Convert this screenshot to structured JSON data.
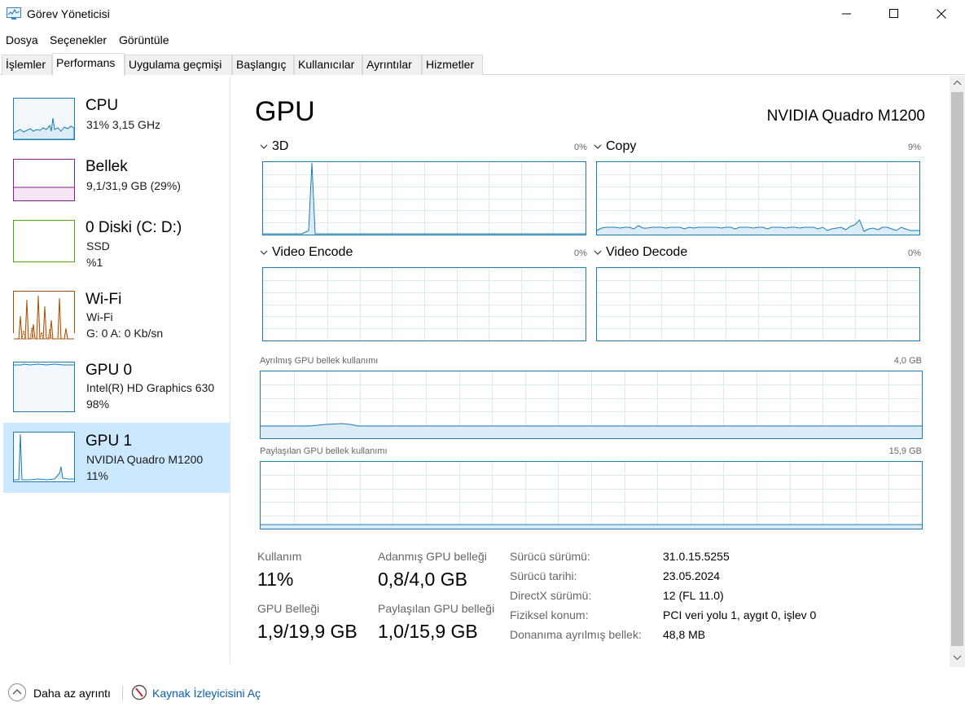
{
  "window": {
    "title": "Görev Yöneticisi"
  },
  "menu": [
    "Dosya",
    "Seçenekler",
    "Görüntüle"
  ],
  "tabs": [
    "İşlemler",
    "Performans",
    "Uygulama geçmişi",
    "Başlangıç",
    "Kullanıcılar",
    "Ayrıntılar",
    "Hizmetler"
  ],
  "active_tab": "Performans",
  "sidebar": {
    "items": [
      {
        "name": "CPU",
        "line1": "31%  3,15 GHz",
        "line2": "",
        "color": "#1b7cb5"
      },
      {
        "name": "Bellek",
        "line1": "9,1/31,9 GB (29%)",
        "line2": "",
        "color": "#8e1a8e"
      },
      {
        "name": "0 Diski (C: D:)",
        "line1": "SSD",
        "line2": "%1",
        "color": "#4da60c"
      },
      {
        "name": "Wi-Fi",
        "line1": "Wi-Fi",
        "line2": "G: 0  A: 0 Kb/sn",
        "color": "#a74f01"
      },
      {
        "name": "GPU 0",
        "line1": "Intel(R) HD Graphics 630",
        "line2": "98%",
        "color": "#1b7cb5"
      },
      {
        "name": "GPU 1",
        "line1": "NVIDIA Quadro M1200",
        "line2": "11%",
        "color": "#1b7cb5",
        "selected": true
      }
    ]
  },
  "main": {
    "title": "GPU",
    "model": "NVIDIA Quadro M1200",
    "engines": [
      {
        "label": "3D",
        "pct": "0%"
      },
      {
        "label": "Copy",
        "pct": "9%"
      },
      {
        "label": "Video Encode",
        "pct": "0%"
      },
      {
        "label": "Video Decode",
        "pct": "0%"
      }
    ],
    "dedicated_mem": {
      "label": "Ayrılmış GPU bellek kullanımı",
      "max": "4,0 GB"
    },
    "shared_mem": {
      "label": "Paylaşılan GPU bellek kullanımı",
      "max": "15,9 GB"
    },
    "stats": {
      "usage_label": "Kullanım",
      "usage_value": "11%",
      "dedicated_label": "Adanmış GPU belleği",
      "dedicated_value": "0,8/4,0 GB",
      "gpu_mem_label": "GPU Belleği",
      "gpu_mem_value": "1,9/19,9 GB",
      "shared_label": "Paylaşılan GPU belleği",
      "shared_value": "1,0/15,9 GB"
    },
    "details": [
      {
        "key": "Sürücü sürümü:",
        "value": "31.0.15.5255"
      },
      {
        "key": "Sürücü tarihi:",
        "value": "23.05.2024"
      },
      {
        "key": "DirectX sürümü:",
        "value": "12 (FL 11.0)"
      },
      {
        "key": "Fiziksel konum:",
        "value": "PCI veri yolu 1, aygıt 0, işlev 0"
      },
      {
        "key": "Donanıma ayrılmış bellek:",
        "value": "48,8 MB"
      }
    ]
  },
  "footer": {
    "less_details": "Daha az ayrıntı",
    "resource_monitor": "Kaynak İzleyicisini Aç"
  }
}
